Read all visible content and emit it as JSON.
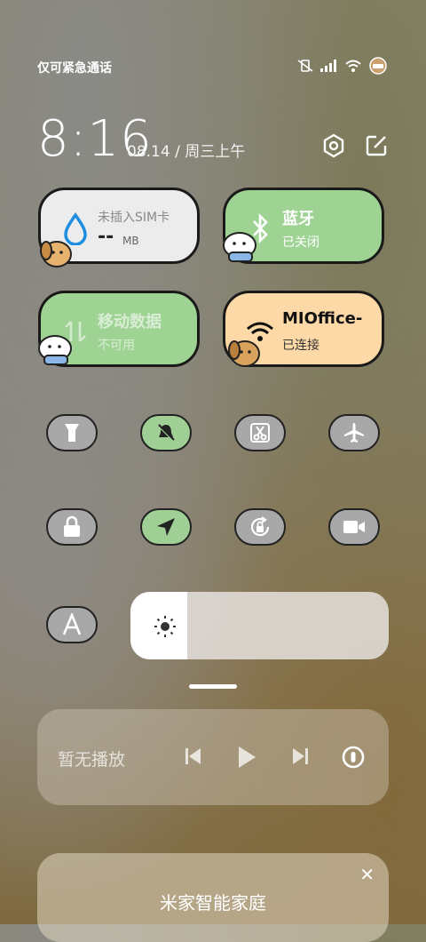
{
  "status": {
    "carrier_text": "仅可紧急通话"
  },
  "header": {
    "time": "8:16",
    "date": "08.14 / 周三上午"
  },
  "tiles": {
    "sim": {
      "title": "未插入SIM卡",
      "value": "--",
      "unit": "MB",
      "bg": "#ececec"
    },
    "bluetooth": {
      "title": "蓝牙",
      "status": "已关闭",
      "bg": "#9fd394"
    },
    "mobile_data": {
      "title": "移动数据",
      "status": "不可用",
      "bg": "#9fd394"
    },
    "wifi": {
      "title": "MIOffice-",
      "status": "已连接",
      "bg": "#fdd9a8"
    }
  },
  "toggles": [
    {
      "name": "flashlight",
      "icon": "flashlight-icon",
      "on": false
    },
    {
      "name": "mute",
      "icon": "bell-off-icon",
      "on": true
    },
    {
      "name": "screenshot",
      "icon": "scissors-icon",
      "on": false
    },
    {
      "name": "airplane",
      "icon": "airplane-icon",
      "on": false
    },
    {
      "name": "lock",
      "icon": "lock-icon",
      "on": false
    },
    {
      "name": "location",
      "icon": "location-arrow-icon",
      "on": true
    },
    {
      "name": "rotation-lock",
      "icon": "rotation-lock-icon",
      "on": false
    },
    {
      "name": "screen-record",
      "icon": "video-camera-icon",
      "on": false
    },
    {
      "name": "auto-text",
      "icon": "letter-a-icon",
      "on": false
    }
  ],
  "brightness": {
    "level": 0.22
  },
  "media": {
    "placeholder": "暂无播放"
  },
  "home_card": {
    "title": "米家智能家庭",
    "close": "✕"
  }
}
